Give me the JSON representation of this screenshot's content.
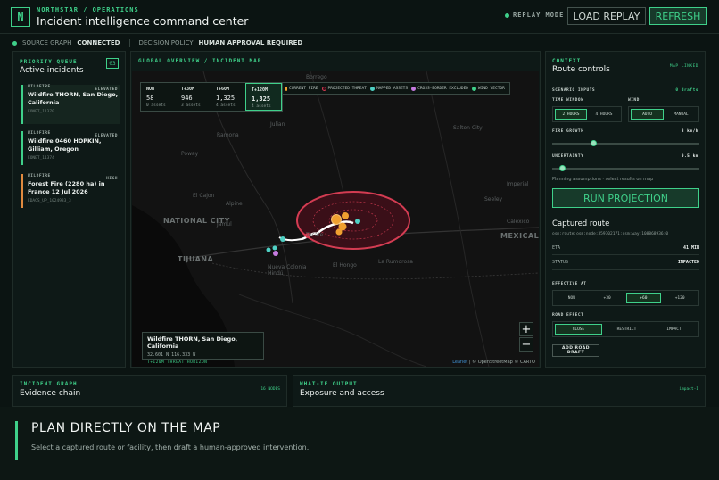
{
  "header": {
    "logo": "N",
    "org": "NORTHSTAR / OPERATIONS",
    "title": "Incident intelligence command center",
    "mode_label": "REPLAY MODE",
    "load_replay": "LOAD REPLAY",
    "refresh": "REFRESH"
  },
  "status": {
    "source_label": "SOURCE GRAPH",
    "source_value": "CONNECTED",
    "policy_label": "DECISION POLICY",
    "policy_value": "HUMAN APPROVAL REQUIRED"
  },
  "queue": {
    "sub": "PRIORITY QUEUE",
    "title": "Active incidents",
    "count": "03",
    "items": [
      {
        "type": "WILDFIRE",
        "severity": "ELEVATED",
        "name": "Wildfire THORN, San Diego, California",
        "id": "EONET_11370"
      },
      {
        "type": "WILDFIRE",
        "severity": "ELEVATED",
        "name": "Wildfire 0460 HOPKIN, Gilliam, Oregon",
        "id": "EONET_11374"
      },
      {
        "type": "WILDFIRE",
        "severity": "HIGH",
        "name": "Forest Fire (2280 ha) in France 12 Jul 2026",
        "id": "EDACS_UP_1024983_3"
      }
    ]
  },
  "map": {
    "sub": "GLOBAL OVERVIEW / INCIDENT MAP",
    "timeline": [
      {
        "label": "NOW",
        "value": "58",
        "sub": "0 assets"
      },
      {
        "label": "T+30M",
        "value": "946",
        "sub": "3 assets"
      },
      {
        "label": "T+60M",
        "value": "1,325",
        "sub": "4 assets"
      },
      {
        "label": "T+120M",
        "value": "1,325",
        "sub": "4 assets"
      }
    ],
    "legend": [
      "CURRENT FIRE",
      "PROJECTED THREAT",
      "MAPPED ASSETS",
      "CROSS-BORDER EXCLUDED",
      "WIND VECTOR"
    ],
    "legend_colors": [
      "#f0a030",
      "#d33c52",
      "#4fd1c5",
      "#c67be0",
      "#3fd08a"
    ],
    "places": [
      "Borrego",
      "Julian",
      "Ramona",
      "Poway",
      "El Cajon",
      "Alpine",
      "Jamul",
      "NATIONAL CITY",
      "TIJUANA",
      "Tecate",
      "Nueva Colonia Hindú",
      "El Hongo",
      "La Rumorosa",
      "MEXICALI",
      "Imperial",
      "Seeley",
      "Calexico",
      "Salton City"
    ],
    "card": {
      "name": "Wildfire THORN, San Diego, California",
      "coords": "32.601 N 116.333 W",
      "horizon": "T+120M THREAT HORIZON"
    },
    "zoom_in": "+",
    "zoom_out": "−",
    "attribution_link": "Leaflet",
    "attribution_rest": " | © OpenStreetMap © CARTO"
  },
  "context": {
    "sub": "CONTEXT",
    "title": "Route controls",
    "tag": "MAP LINKED",
    "scenario_label": "SCENARIO INPUTS",
    "scenario_value": "0 drafts",
    "time_label": "TIME WINDOW",
    "time_options": [
      "2 HOURS",
      "4 HOURS"
    ],
    "wind_label": "WIND",
    "wind_options": [
      "AUTO",
      "MANUAL"
    ],
    "growth_label": "FIRE GROWTH",
    "growth_value": "8 km/h",
    "growth_level": 0.28,
    "uncert_label": "UNCERTAINTY",
    "uncert_value": "0.5 km",
    "uncert_level": 0.05,
    "note": "Planning assumptions · select results on map",
    "run": "RUN PROJECTION",
    "captured_title": "Captured route",
    "captured_id": "osm:route:osm:node:359702171:osm:way:108868936:0",
    "eta_label": "ETA",
    "eta_value": "41 MIN",
    "status_label": "STATUS",
    "status_value": "IMPACTED",
    "effective_label": "EFFECTIVE AT",
    "effective_options": [
      "NOW",
      "+30",
      "+60",
      "+120"
    ],
    "road_label": "ROAD EFFECT",
    "road_options": [
      "CLOSE",
      "RESTRICT",
      "IMPACT"
    ],
    "draft": "ADD ROAD DRAFT"
  },
  "graph": {
    "sub": "INCIDENT GRAPH",
    "title": "Evidence chain",
    "tag": "16 NODES"
  },
  "whatif": {
    "sub": "WHAT-IF OUTPUT",
    "title": "Exposure and access",
    "tag": "impact-1"
  },
  "footer": {
    "title": "PLAN DIRECTLY ON THE MAP",
    "subtitle": "Select a captured route or facility, then draft a human-approved intervention."
  }
}
